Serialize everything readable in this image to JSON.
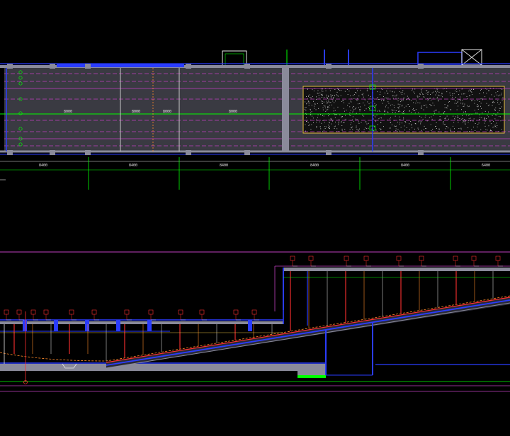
{
  "drawing": {
    "background": "#000000",
    "colors": {
      "magenta": "#c040c0",
      "green": "#00ff00",
      "grey": "#8a8a9a",
      "panel": "#3a3a42",
      "blue": "#2a3cff",
      "red": "#ff3030",
      "orange": "#ff8a2a",
      "white": "#e8e8e8",
      "yellow": "#e8c040"
    },
    "plan": {
      "dimensions": [
        "8400",
        "8400",
        "8400",
        "8400",
        "8400",
        "6400"
      ],
      "center_labels": [
        "8000",
        "8000",
        "8000",
        "8000"
      ]
    },
    "section": {
      "note": ""
    }
  }
}
